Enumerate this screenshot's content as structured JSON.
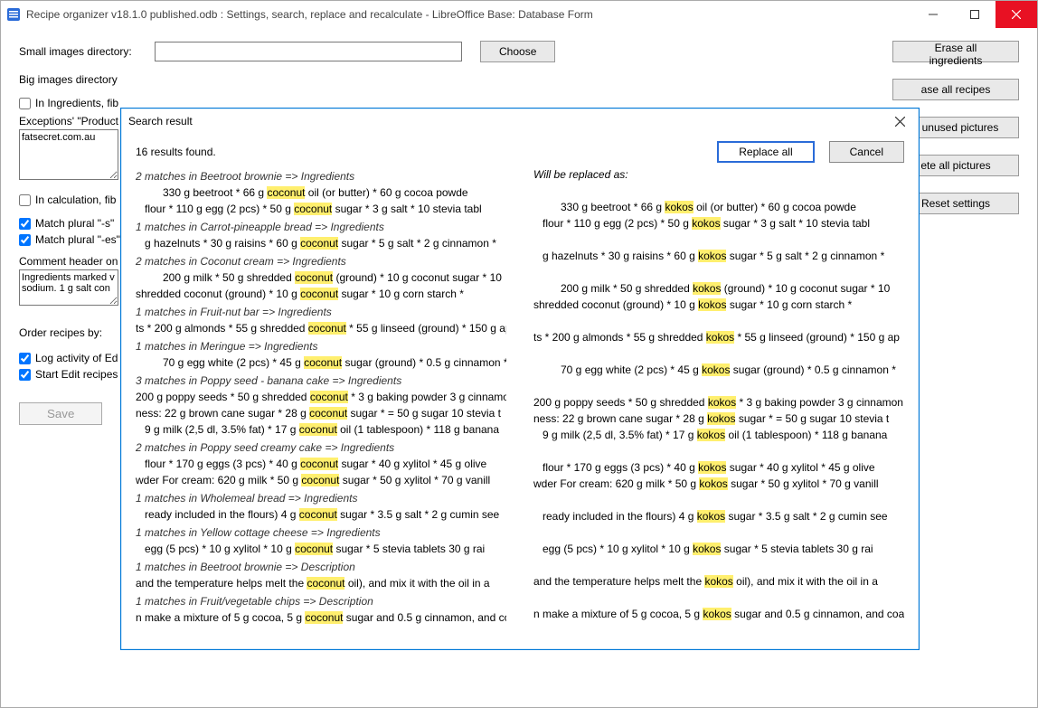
{
  "window": {
    "title": "Recipe organizer v18.1.0 published.odb : Settings, search, replace and recalculate - LibreOffice Base: Database Form"
  },
  "labels": {
    "small_images_dir": "Small images directory:",
    "big_images_dir": "Big images directory",
    "choose": "Choose",
    "in_ingredients": "In Ingredients, fib",
    "exceptions": "Exceptions' \"Product",
    "exceptions_val": "fatsecret.com.au",
    "in_calc": "In calculation, fib",
    "match_plural_s": "Match plural \"-s\"",
    "match_plural_es": "Match plural \"-es\"",
    "comment_header": "Comment header on",
    "comment_val": "Ingredients marked v\nsodium. 1 g salt con",
    "order_recipes": "Order recipes by:",
    "log_activity": "Log activity of Ed",
    "start_edit": "Start Edit recipes",
    "save": "Save"
  },
  "right_buttons": {
    "erase_ing": "Erase all ingredients",
    "erase_rec": "ase all recipes",
    "unused": "e unused pictures",
    "delete_pic": "ete all pictures",
    "reset": "Reset settings"
  },
  "dialog": {
    "title": "Search result",
    "info": "16 results found.",
    "replace_all": "Replace all",
    "cancel": "Cancel",
    "preview_hdr": "Will be replaced as:",
    "search_word": "coconut",
    "replace_word": "kokos",
    "blocks": [
      {
        "hdr": "2 matches in Beetroot brownie => Ingredients",
        "lines": [
          {
            "pre": "330 g beetroot * 66 g ",
            "post": " oil (or butter) * 60 g cocoa powde",
            "cls": "l2"
          },
          {
            "pre": "flour *  110 g egg (2 pcs) * 50 g ",
            "post": " sugar * 3 g salt *  10 stevia tabl",
            "cls": ""
          }
        ]
      },
      {
        "hdr": "1 matches in Carrot-pineapple bread => Ingredients",
        "lines": [
          {
            "pre": "g hazelnuts * 30 g raisins *  60 g ",
            "post": " sugar * 5 g salt * 2 g cinnamon *",
            "cls": ""
          }
        ]
      },
      {
        "hdr": "2 matches in Coconut cream => Ingredients",
        "lines": [
          {
            "pre": "200 g milk * 50 g shredded ",
            "post": " (ground) * 10 g coconut sugar * 10",
            "cls": "l2"
          },
          {
            "pre": "shredded coconut (ground) * 10 g ",
            "post": " sugar * 10 g corn starch *",
            "cls": "l3"
          }
        ]
      },
      {
        "hdr": "1 matches in Fruit-nut bar => Ingredients",
        "lines": [
          {
            "pre": "ts * 200 g almonds * 55 g shredded ",
            "post": " * 55 g linseed (ground) * 150 g ap",
            "cls": "l3"
          }
        ]
      },
      {
        "hdr": "1 matches in Meringue => Ingredients",
        "lines": [
          {
            "pre": "70 g egg white (2 pcs) * 45 g ",
            "post": " sugar (ground) *  0.5 g cinnamon *",
            "cls": "l2"
          }
        ]
      },
      {
        "hdr": "3 matches in Poppy seed - banana cake => Ingredients",
        "lines": [
          {
            "pre": "200 g poppy seeds * 50 g shredded ",
            "post": " * 3 g baking powder 3 g cinnamon",
            "cls": "l3"
          },
          {
            "pre": "ness: 22 g brown cane sugar * 28 g ",
            "post": " sugar *  = 50 g sugar 10 stevia t",
            "cls": "l3"
          },
          {
            "pre": "9 g milk (2,5 dl, 3.5% fat) * 17 g ",
            "post": " oil (1 tablespoon) *  118 g banana",
            "cls": ""
          }
        ]
      },
      {
        "hdr": "2 matches in Poppy seed creamy cake => Ingredients",
        "lines": [
          {
            "pre": "flour * 170 g eggs (3 pcs) * 40 g ",
            "post": " sugar * 40 g xylitol * 45 g olive",
            "cls": ""
          },
          {
            "pre": "wder  For cream: 620 g milk * 50 g ",
            "post": " sugar * 50 g xylitol * 70 g vanill",
            "cls": "l3"
          }
        ]
      },
      {
        "hdr": "1 matches in Wholemeal bread => Ingredients",
        "lines": [
          {
            "pre": "ready included in the flours)  4 g ",
            "post": " sugar * 3.5 g salt * 2 g cumin see",
            "cls": ""
          }
        ]
      },
      {
        "hdr": "1 matches in Yellow cottage cheese => Ingredients",
        "lines": [
          {
            "pre": "egg (5 pcs) *  10 g xylitol * 10 g ",
            "post": " sugar * 5 stevia tablets  30 g rai",
            "cls": ""
          }
        ]
      },
      {
        "hdr": "1 matches in Beetroot brownie => Description",
        "lines": [
          {
            "pre": "and the temperature helps melt the ",
            "post": " oil), and mix it with the oil in a",
            "cls": "l3"
          }
        ]
      },
      {
        "hdr": "1 matches in Fruit/vegetable chips => Description",
        "lines": [
          {
            "pre": "n make a mixture of 5 g cocoa, 5 g ",
            "post": " sugar and 0.5 g cinnamon, and coa",
            "cls": "l3"
          }
        ]
      }
    ]
  }
}
